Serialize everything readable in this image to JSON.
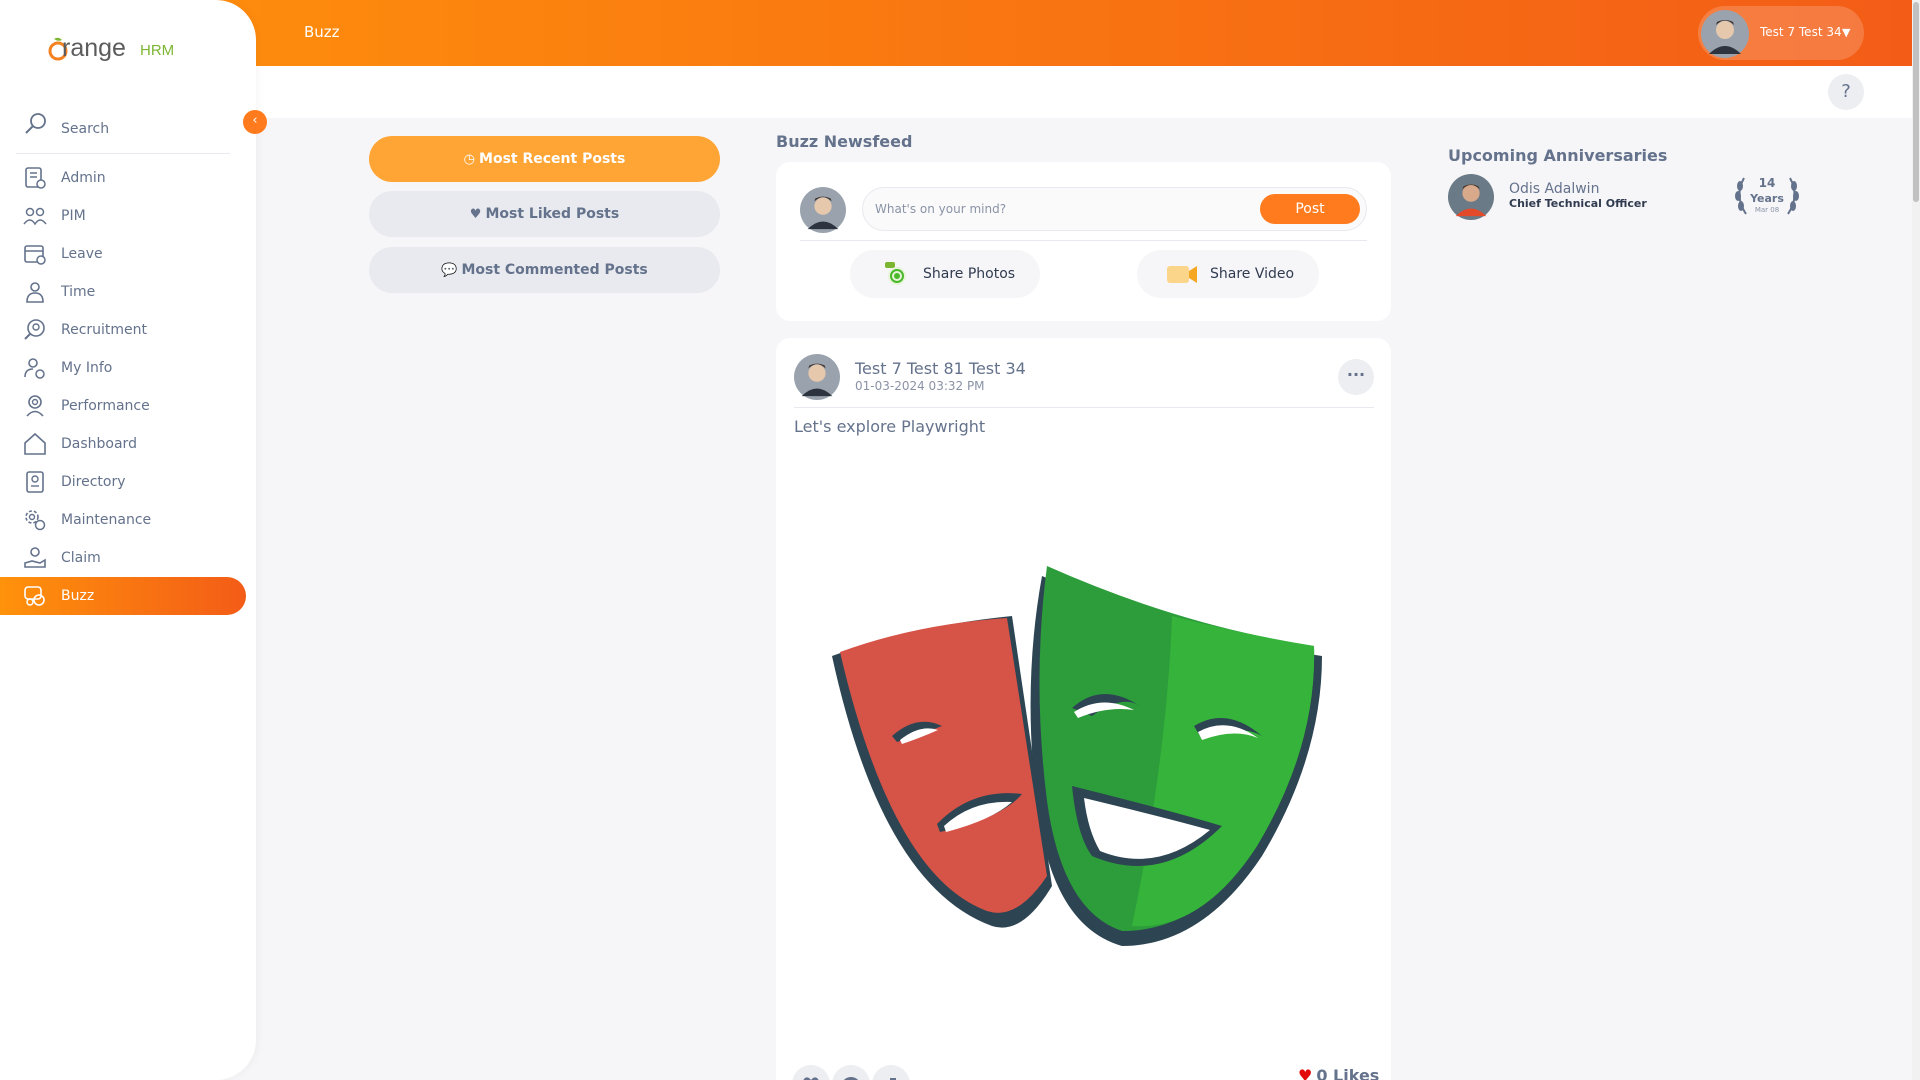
{
  "header": {
    "title": "Buzz",
    "user_name": "Test 7 Test 34",
    "help": "?"
  },
  "sidebar": {
    "search_label": "Search",
    "items": [
      {
        "label": "Admin",
        "icon": "admin-icon"
      },
      {
        "label": "PIM",
        "icon": "pim-icon"
      },
      {
        "label": "Leave",
        "icon": "leave-icon"
      },
      {
        "label": "Time",
        "icon": "time-icon"
      },
      {
        "label": "Recruitment",
        "icon": "recruitment-icon"
      },
      {
        "label": "My Info",
        "icon": "my-info-icon"
      },
      {
        "label": "Performance",
        "icon": "performance-icon"
      },
      {
        "label": "Dashboard",
        "icon": "dashboard-icon"
      },
      {
        "label": "Directory",
        "icon": "directory-icon"
      },
      {
        "label": "Maintenance",
        "icon": "maintenance-icon"
      },
      {
        "label": "Claim",
        "icon": "claim-icon"
      },
      {
        "label": "Buzz",
        "icon": "buzz-icon",
        "active": true
      }
    ]
  },
  "filters": {
    "most_recent": "Most Recent Posts",
    "most_liked": "Most Liked Posts",
    "most_commented": "Most Commented Posts"
  },
  "newsfeed": {
    "title": "Buzz Newsfeed",
    "compose_placeholder": "What's on your mind?",
    "post_button": "Post",
    "share_photos": "Share Photos",
    "share_video": "Share Video"
  },
  "post": {
    "author": "Test 7 Test 81 Test 34",
    "date": "01-03-2024 03:32 PM",
    "text": "Let's explore Playwright",
    "likes": "0 Likes",
    "more": "···"
  },
  "anniversaries": {
    "title": "Upcoming Anniversaries",
    "name": "Odis Adalwin",
    "job_title": "Chief Technical Officer",
    "years": "14",
    "years_label": "Years",
    "date": "Mar 08"
  },
  "colors": {
    "brand_orange": "#ff7b1d",
    "active_filter": "#ffa535",
    "text_muted": "#64728c",
    "like_red": "#e30a0a"
  }
}
